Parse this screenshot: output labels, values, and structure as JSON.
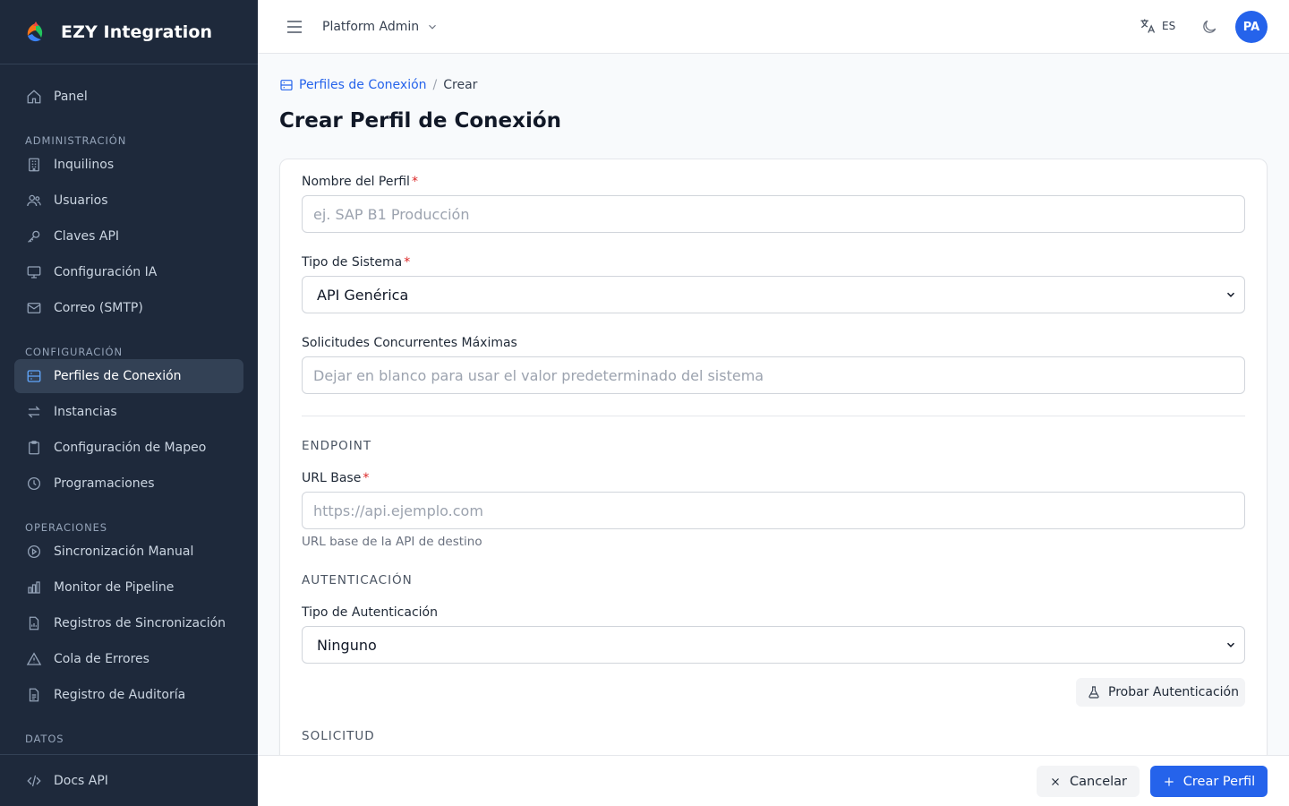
{
  "sidebar": {
    "brand": "EZY Integration",
    "items": [
      {
        "label": "Panel",
        "icon": "home-icon"
      },
      {
        "label": "Inquilinos",
        "icon": "building-icon"
      },
      {
        "label": "Usuarios",
        "icon": "users-icon"
      },
      {
        "label": "Claves API",
        "icon": "key-icon"
      },
      {
        "label": "Configuración IA",
        "icon": "monitor-icon"
      },
      {
        "label": "Correo (SMTP)",
        "icon": "mail-icon"
      },
      {
        "label": "Perfiles de Conexión",
        "icon": "server-icon",
        "active": true
      },
      {
        "label": "Instancias",
        "icon": "swap-icon"
      },
      {
        "label": "Configuración de Mapeo",
        "icon": "clipboard-icon"
      },
      {
        "label": "Programaciones",
        "icon": "clock-icon"
      },
      {
        "label": "Sincronización Manual",
        "icon": "play-circle-icon"
      },
      {
        "label": "Monitor de Pipeline",
        "icon": "bar-chart-icon"
      },
      {
        "label": "Registros de Sincronización",
        "icon": "file-chart-icon"
      },
      {
        "label": "Cola de Errores",
        "icon": "warning-icon"
      },
      {
        "label": "Registro de Auditoría",
        "icon": "file-text-icon"
      }
    ],
    "sections": {
      "admin": "ADMINISTRACIÓN",
      "config": "CONFIGURACIÓN",
      "ops": "OPERACIONES",
      "data": "DATOS"
    },
    "bottom_item": {
      "label": "Docs API",
      "icon": "code-icon"
    }
  },
  "header": {
    "tenant": "Platform Admin",
    "lang": "ES",
    "avatar": "PA"
  },
  "breadcrumb": {
    "parent": "Perfiles de Conexión",
    "separator": "/",
    "current": "Crear"
  },
  "page": {
    "title": "Crear Perfil de Conexión"
  },
  "form": {
    "profile_name": {
      "label": "Nombre del Perfil",
      "required": "*",
      "placeholder": "ej. SAP B1 Producción",
      "value": ""
    },
    "system_type": {
      "label": "Tipo de Sistema",
      "required": "*",
      "value": "API Genérica"
    },
    "max_requests": {
      "label": "Solicitudes Concurrentes Máximas",
      "placeholder": "Dejar en blanco para usar el valor predeterminado del sistema",
      "value": ""
    },
    "endpoint_section": "ENDPOINT",
    "base_url": {
      "label": "URL Base",
      "required": "*",
      "placeholder": "https://api.ejemplo.com",
      "help": "URL base de la API de destino",
      "value": ""
    },
    "auth_section": "AUTENTICACIÓN",
    "auth_type": {
      "label": "Tipo de Autenticación",
      "value": "Ninguno"
    },
    "test_auth_label": "Probar Autenticación",
    "request_section": "SOLICITUD"
  },
  "footer": {
    "cancel_label": "Cancelar",
    "create_label": "Crear Perfil"
  },
  "colors": {
    "sidebar_bg": "#1e293b",
    "accent": "#2563eb",
    "required": "#dc2626"
  }
}
